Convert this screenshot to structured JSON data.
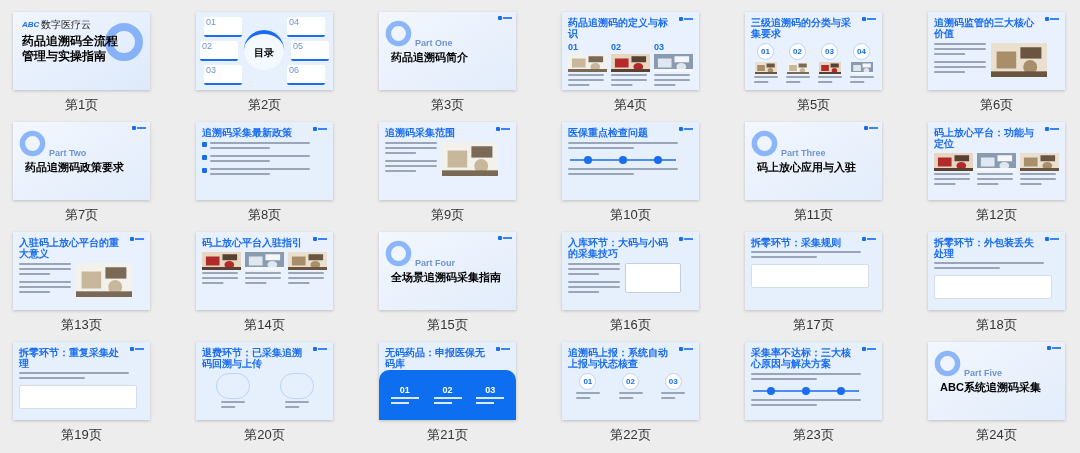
{
  "slides": [
    {
      "caption": "第1页",
      "kind": "cover",
      "brand_mark": "ABC",
      "brand": "数字医疗云",
      "title_lines": [
        "药品追溯码全流程",
        "管理与实操指南"
      ]
    },
    {
      "caption": "第2页",
      "kind": "toc",
      "title": "目录",
      "numbers": [
        "01",
        "02",
        "03",
        "04",
        "05",
        "06"
      ]
    },
    {
      "caption": "第3页",
      "kind": "section",
      "part": "Part One",
      "title": "药品追溯码简介"
    },
    {
      "caption": "第4页",
      "kind": "content",
      "title": "药品追溯码的定义与标识",
      "body": {
        "kind": "columns"
      },
      "numbers": [
        "01",
        "02",
        "03"
      ],
      "photos": true
    },
    {
      "caption": "第5页",
      "kind": "content",
      "title": "三级追溯码的分类与采集要求",
      "body": {
        "kind": "steps"
      },
      "numbers": [
        "01",
        "02",
        "03",
        "04"
      ],
      "photos": true
    },
    {
      "caption": "第6页",
      "kind": "content",
      "title": "追溯码监管的三大核心价值",
      "body": {
        "kind": "split"
      },
      "photos": true
    },
    {
      "caption": "第7页",
      "kind": "section",
      "part": "Part Two",
      "title": "药品追溯码政策要求"
    },
    {
      "caption": "第8页",
      "kind": "content",
      "title": "追溯码采集最新政策",
      "body": {
        "kind": "list"
      }
    },
    {
      "caption": "第9页",
      "kind": "content",
      "title": "追溯码采集范围",
      "body": {
        "kind": "split"
      },
      "photos": true
    },
    {
      "caption": "第10页",
      "kind": "content",
      "title": "医保重点检查问题",
      "body": {
        "kind": "timeline"
      }
    },
    {
      "caption": "第11页",
      "kind": "section",
      "part": "Part Three",
      "title": "码上放心应用与入驻"
    },
    {
      "caption": "第12页",
      "kind": "content",
      "title": "码上放心平台：功能与定位",
      "body": {
        "kind": "columns"
      },
      "photos": true
    },
    {
      "caption": "第13页",
      "kind": "content",
      "title": "入驻码上放心平台的重大意义",
      "body": {
        "kind": "split"
      },
      "photos": true
    },
    {
      "caption": "第14页",
      "kind": "content",
      "title": "码上放心平台入驻指引",
      "body": {
        "kind": "columns"
      },
      "photos": true
    },
    {
      "caption": "第15页",
      "kind": "section",
      "part": "Part Four",
      "title": "全场景追溯码采集指南"
    },
    {
      "caption": "第16页",
      "kind": "content",
      "title": "入库环节：大码与小码的采集技巧",
      "body": {
        "kind": "split"
      }
    },
    {
      "caption": "第17页",
      "kind": "content",
      "title": "拆零环节：采集规则",
      "body": {
        "kind": "table"
      }
    },
    {
      "caption": "第18页",
      "kind": "content",
      "title": "拆零环节：外包装丢失处理",
      "body": {
        "kind": "table"
      }
    },
    {
      "caption": "第19页",
      "kind": "content",
      "title": "拆零环节：重复采集处理",
      "body": {
        "kind": "table"
      }
    },
    {
      "caption": "第20页",
      "kind": "content",
      "title": "退费环节：已采集追溯码回溯与上传",
      "body": {
        "kind": "steps"
      }
    },
    {
      "caption": "第21页",
      "kind": "content",
      "title": "无码药品：申报医保无码库",
      "body": {
        "kind": "wave"
      },
      "numbers": [
        "01",
        "02",
        "03"
      ]
    },
    {
      "caption": "第22页",
      "kind": "content",
      "title": "追溯码上报：系统自动上报与状态核查",
      "body": {
        "kind": "steps"
      },
      "numbers": [
        "01",
        "02",
        "03"
      ]
    },
    {
      "caption": "第23页",
      "kind": "content",
      "title": "采集率不达标：三大核心原因与解决方案",
      "body": {
        "kind": "timeline"
      }
    },
    {
      "caption": "第24页",
      "kind": "section",
      "part": "Part Five",
      "title": "ABC系统追溯码采集"
    }
  ]
}
